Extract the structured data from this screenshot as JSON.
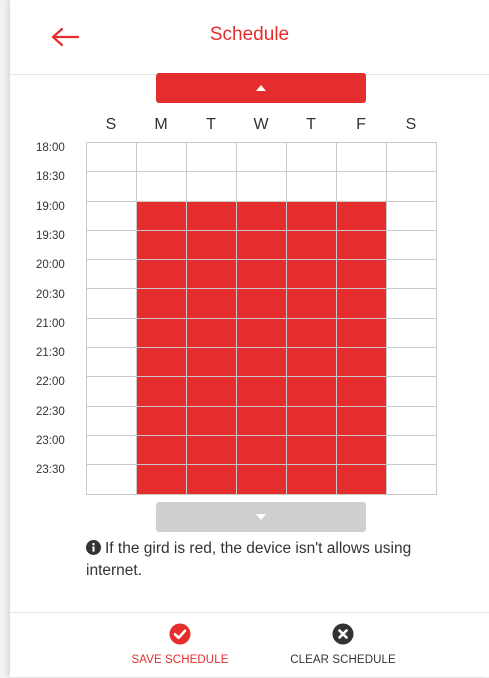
{
  "header": {
    "title": "Schedule",
    "back_icon": "arrow-left-icon"
  },
  "nav": {
    "up_icon": "caret-up-icon",
    "down_icon": "caret-down-icon"
  },
  "days": [
    "S",
    "M",
    "T",
    "W",
    "T",
    "F",
    "S"
  ],
  "times": [
    "18:00",
    "18:30",
    "19:00",
    "19:30",
    "20:00",
    "20:30",
    "21:00",
    "21:30",
    "22:00",
    "22:30",
    "23:00",
    "23:30"
  ],
  "blocked": {
    "days": [
      "M",
      "T",
      "W",
      "T",
      "F"
    ],
    "from": "19:00",
    "to": "24:00"
  },
  "note": {
    "icon": "info-icon",
    "text": "If the gird is red, the device isn't allows using internet."
  },
  "actions": {
    "save_label": "SAVE SCHEDULE",
    "clear_label": "CLEAR SCHEDULE",
    "save_icon": "check-circle-icon",
    "clear_icon": "x-circle-icon"
  },
  "colors": {
    "accent": "#e52d2d",
    "grid_line": "#c9c9c9",
    "disabled": "#cfcfcf",
    "text": "#333333"
  }
}
